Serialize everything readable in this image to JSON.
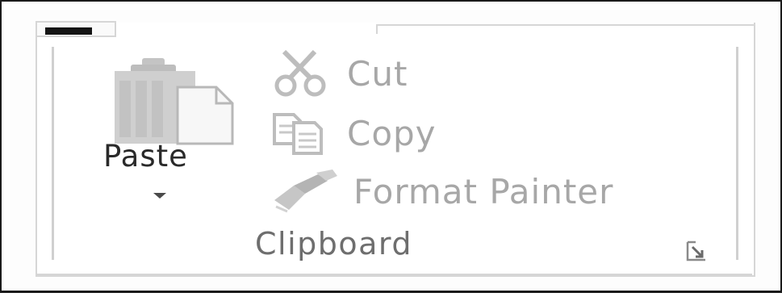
{
  "clipboard_group": {
    "label": "Clipboard",
    "paste": {
      "label": "Paste",
      "icon": "clipboard-paste-icon",
      "dropdown_icon": "chevron-down-icon"
    },
    "commands": {
      "cut": {
        "label": "Cut",
        "icon": "scissors-icon"
      },
      "copy": {
        "label": "Copy",
        "icon": "copy-icon"
      },
      "format_painter": {
        "label": "Format Painter",
        "icon": "paintbrush-icon"
      }
    },
    "launcher_icon": "dialog-launcher-icon"
  },
  "colors": {
    "disabled_text": "#a7a7a7",
    "group_label": "#6e6e6e",
    "paste_text": "#2a2a2a",
    "border": "#d6d6d6"
  }
}
